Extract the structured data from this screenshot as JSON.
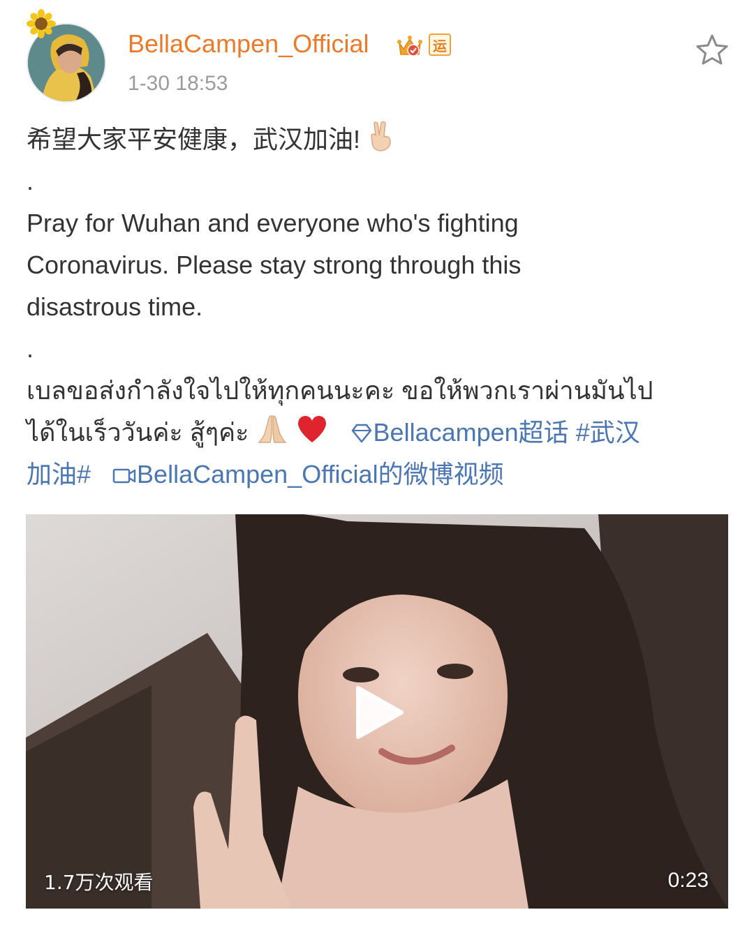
{
  "post": {
    "username": "BellaCampen_Official",
    "badge_text": "运",
    "timestamp": "1-30 18:53",
    "text": {
      "line1": "希望大家平安健康，武汉加油!",
      "dot1": ".",
      "english": [
        "Pray for Wuhan and everyone who's fighting",
        "Coronavirus. Please stay strong through this",
        "disastrous time."
      ],
      "dot2": ".",
      "thai1": "เบลขอส่งกำลังใจไปให้ทุกคนนะคะ ขอให้พวกเราผ่านมันไป",
      "thai2": "ได้ในเร็ววันค่ะ สู้ๆค่ะ",
      "supertopic_link": "Bellacampen超话",
      "hashtag_part1": "#武汉",
      "hashtag_part2": "加油#",
      "video_link": "BellaCampen_Official的微博视频"
    },
    "icons": {
      "avatar_badge": "sunflower-icon",
      "verified": "crown-icon",
      "favorite": "star-icon",
      "emoji1": "victory-hand-icon",
      "emoji2": "folded-hands-icon",
      "emoji3": "red-heart-icon",
      "supertopic": "diamond-icon",
      "video": "video-camera-icon",
      "play": "play-icon"
    },
    "colors": {
      "username": "#ec7a28",
      "link": "#4a77b4",
      "meta": "#9b9b9b",
      "text": "#333333"
    }
  },
  "video": {
    "views": "1.7万次观看",
    "duration": "0:23"
  }
}
